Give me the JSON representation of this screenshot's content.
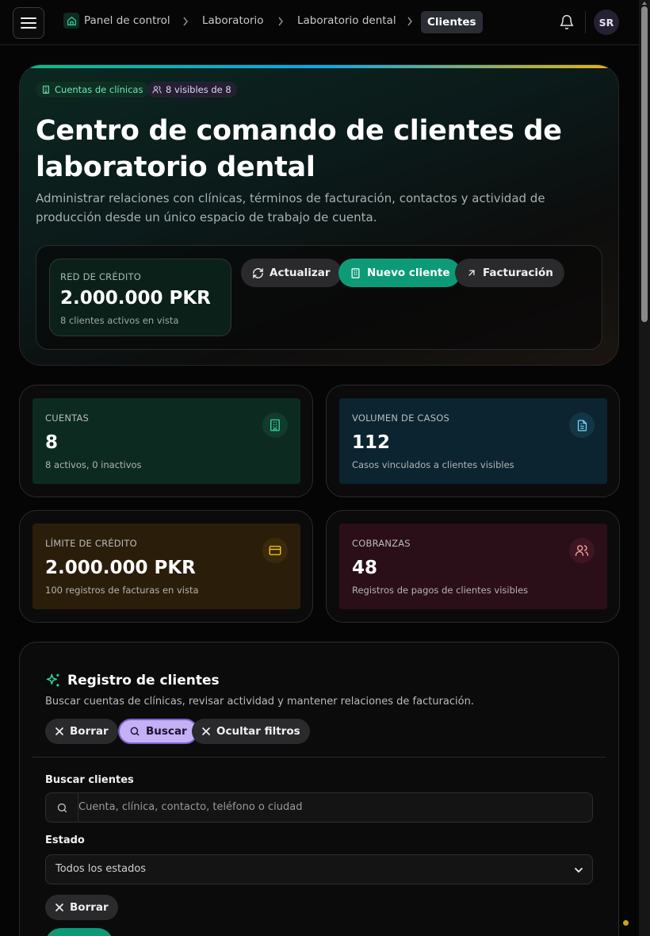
{
  "breadcrumb": {
    "items": [
      "Panel de control",
      "Laboratorio",
      "Laboratorio dental"
    ],
    "current": "Clientes"
  },
  "user": {
    "initials": "SR"
  },
  "hero": {
    "badge_accounts": "Cuentas de clínicas",
    "badge_visible": "8 visibles de 8",
    "title": "Centro de comando de clientes de laboratorio dental",
    "description": "Administrar relaciones con clínicas, términos de facturación, contactos y actividad de producción desde un único espacio de trabajo de cuenta.",
    "credit": {
      "label": "RED DE CRÉDITO",
      "value": "2.000.000 PKR",
      "sub": "8 clientes activos en vista"
    },
    "actions": {
      "refresh": "Actualizar",
      "new_client": "Nuevo cliente",
      "billing": "Facturación"
    }
  },
  "stats": [
    {
      "label": "CUENTAS",
      "value": "8",
      "sub": "8 activos, 0 inactivos",
      "icon": "building-icon",
      "accent": "#34d399"
    },
    {
      "label": "VOLUMEN DE CASOS",
      "value": "112",
      "sub": "Casos vinculados a clientes visibles",
      "icon": "document-icon",
      "accent": "#7dd3fc"
    },
    {
      "label": "LÍMITE DE CRÉDITO",
      "value": "2.000.000 PKR",
      "sub": "100 registros de facturas en vista",
      "icon": "credit-card-icon",
      "accent": "#facc15"
    },
    {
      "label": "COBRANZAS",
      "value": "48",
      "sub": "Registros de pagos de clientes visibles",
      "icon": "users-icon",
      "accent": "#fca5a5"
    }
  ],
  "registry": {
    "title": "Registro de clientes",
    "description": "Buscar cuentas de clínicas, revisar actividad y mantener relaciones de facturación.",
    "actions": {
      "clear": "Borrar",
      "search": "Buscar",
      "hide_filters": "Ocultar filtros"
    },
    "search": {
      "label": "Buscar clientes",
      "placeholder": "Cuenta, clínica, contacto, teléfono o ciudad"
    },
    "status": {
      "label": "Estado",
      "selected": "Todos los estados"
    },
    "clear_filters": "Borrar"
  },
  "colors": {
    "accent_green": "#0d9a77",
    "accent_purple": "#c4b0f5"
  }
}
